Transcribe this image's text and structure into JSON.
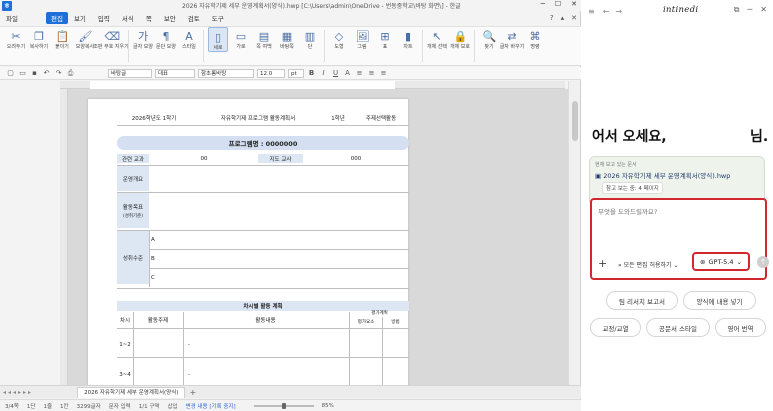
{
  "window": {
    "title": "2026 자유학기제 세부 운영계획서(양식).hwp [C:\\Users\\admin\\OneDrive - 번동중학교\\바탕 화면\\] - 한글"
  },
  "menu": {
    "items": [
      "파일",
      "편집",
      "보기",
      "입력",
      "서식",
      "쪽",
      "보안",
      "검토",
      "도구"
    ],
    "active_index": 1
  },
  "ribbon": {
    "tools": [
      "오려두기",
      "복사하기",
      "붙이기",
      "모양복사",
      "조판 부호 지우기",
      "글자 모양",
      "문단 모양",
      "스타일",
      "세로",
      "가로",
      "쪽 여백",
      "바탕쪽",
      "단",
      "도형",
      "그림",
      "표",
      "차트",
      "개체 선택",
      "개체 보호",
      "찾기",
      "글자 바꾸기",
      "명령"
    ]
  },
  "format": {
    "style": "바탕글",
    "lang": "대표",
    "font": "함초롬바탕",
    "size": "12.0",
    "unit": "pt"
  },
  "doc": {
    "header_cells": [
      "2026학년도 1학기",
      "자유학기제 프로그램 활동계획서",
      "1학년",
      "주제선택활동"
    ],
    "program_name": "프로그램명 : 0000000",
    "related_subject_label": "관련 교과",
    "related_subject_value": "00",
    "teacher_label": "지도 교사",
    "teacher_value": "000",
    "overview_label": "운영개요",
    "goal_label": "활동목표",
    "goal_sub": "(성취기준)",
    "achievement_label": "성취수준",
    "levels": [
      "A",
      "B",
      "C"
    ],
    "section_title": "차시별 활동 계획",
    "plan_headers": [
      "차시",
      "활동주제",
      "활동내용",
      "평가계획",
      "평가요소",
      "방법"
    ],
    "plan_rows": [
      {
        "session": "1~2",
        "content": "-"
      },
      {
        "session": "3~4",
        "content": "-"
      }
    ]
  },
  "tabs": {
    "doc_tab": "2026 자유학기제 세부 운영계획서(양식)",
    "add": "+"
  },
  "status": {
    "page": "3/4쪽",
    "section": "1단",
    "line": "1줄",
    "col": "1칸",
    "chars": "3299글자",
    "mode": "문자 입력",
    "area": "1/1 구역",
    "insert": "삽입",
    "track": "변경 내용 [기록 중지]",
    "zoom": "85%"
  },
  "assistant": {
    "brand": "intinedi",
    "greeting": "어서 오세요,",
    "greeting_suffix": "님.",
    "doc_hint": "현재 보고 있는 문서",
    "doc_name": "2026 자유학기제 세부 운영계획서(양식).hwp",
    "pages": "참고 보는 중: 4 페이지",
    "prompt_placeholder": "무엇을 도와드릴까요?",
    "mode_label": "모든 편집 허용하기",
    "model": "GPT-5.4",
    "suggestions": [
      "팀 리서치 보고서",
      "양식에 내용 넣기",
      "교정/교열",
      "공문서 스타일",
      "영어 번역"
    ]
  }
}
